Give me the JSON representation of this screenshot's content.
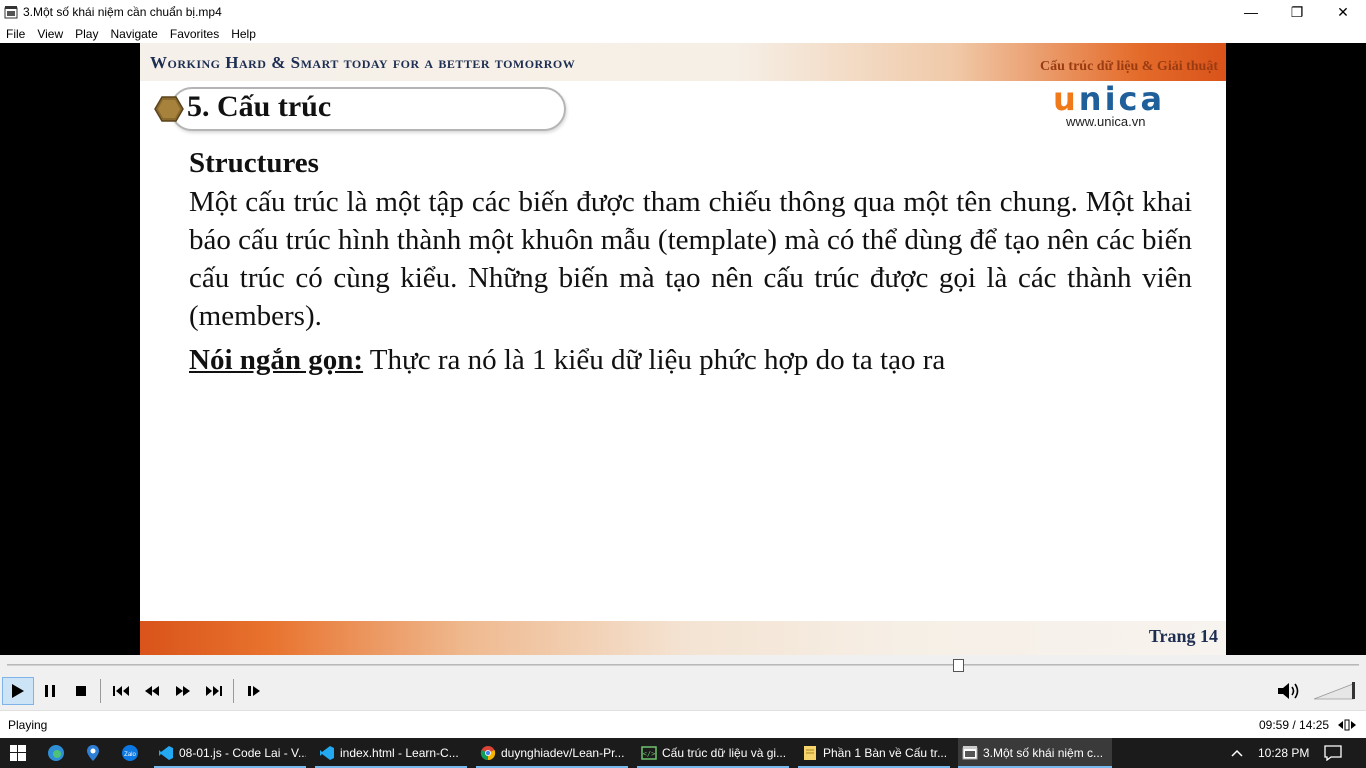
{
  "window": {
    "title": "3.Một số khái niệm cần chuẩn bị.mp4",
    "minimize_glyph": "—",
    "maximize_glyph": "❐",
    "close_glyph": "✕"
  },
  "menu": [
    {
      "label": "File"
    },
    {
      "label": "View"
    },
    {
      "label": "Play"
    },
    {
      "label": "Navigate"
    },
    {
      "label": "Favorites"
    },
    {
      "label": "Help"
    }
  ],
  "slide": {
    "motto": "Working Hard & Smart today for a better tomorrow",
    "course": "Cấu trúc dữ liệu & Giải thuật",
    "logo_u": "u",
    "logo_rest": "nica",
    "logo_url": "www.unica.vn",
    "heading": "5. Cấu trúc",
    "subheading": "Structures",
    "paragraph": "Một cấu trúc là một tập các biến được tham chiếu thông qua một tên chung. Một khai báo cấu trúc hình thành một khuôn mẫu (template) mà có thể dùng để tạo nên các biến cấu trúc có cùng kiểu. Những biến mà tạo nên cấu trúc được gọi là các thành viên (members).",
    "summary_label": "Nói ngắn gọn:",
    "summary_text": " Thực ra nó là 1 kiểu dữ liệu phức hợp do ta tạo ra",
    "page_label": "Trang 14"
  },
  "player": {
    "progress_fraction": 0.704,
    "status": "Playing",
    "time": "09:59 / 14:25",
    "buttons": [
      "play",
      "pause",
      "stop",
      "previous",
      "rewind",
      "fast-forward",
      "next",
      "frame-step"
    ]
  },
  "taskbar": {
    "apps": [
      {
        "label": "08-01.js - Code Lai - V...",
        "icon": "vscode-icon"
      },
      {
        "label": "index.html - Learn-C...",
        "icon": "vscode-icon"
      },
      {
        "label": "duynghiadev/Lean-Pr...",
        "icon": "chrome-icon"
      },
      {
        "label": "Cấu trúc dữ liệu và gi...",
        "icon": "code-icon"
      },
      {
        "label": "Phần 1 Bàn về Cấu tr...",
        "icon": "note-icon"
      },
      {
        "label": "3.Một số khái niệm c...",
        "icon": "media-player-icon"
      }
    ],
    "clock": "10:28 PM"
  },
  "colors": {
    "accent_orange": "#e46b2a",
    "navy": "#1e2e52",
    "unica_blue": "#1f5f9a",
    "unica_orange": "#f07a1a"
  }
}
